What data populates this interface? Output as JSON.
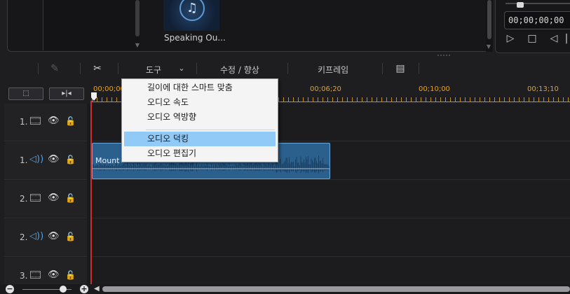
{
  "library": {
    "media_item_label": "Speaking Ou...",
    "media_icon": "music-note-icon"
  },
  "preview": {
    "timecode": "00;00;00;00"
  },
  "toolbar": {
    "tools_label": "도구",
    "fix_enhance_label": "수정 / 향상",
    "keyframe_label": "키프레임"
  },
  "ruler": {
    "labels": [
      "00;00;00",
      "00;06;20",
      "00;10;00",
      "00;13;10"
    ]
  },
  "tracks": [
    {
      "number": "1.",
      "kind": "video"
    },
    {
      "number": "1.",
      "kind": "audio"
    },
    {
      "number": "2.",
      "kind": "video"
    },
    {
      "number": "2.",
      "kind": "audio"
    },
    {
      "number": "3.",
      "kind": "video"
    }
  ],
  "audio_clip": {
    "label": "Mount"
  },
  "tools_menu": {
    "items": [
      {
        "label": "길이에 대한 스마트 맞춤"
      },
      {
        "label": "오디오 속도"
      },
      {
        "label": "오디오 역방향"
      },
      {
        "label": "오디오 덕킹"
      },
      {
        "label": "오디오 편집기"
      }
    ],
    "highlighted_index": 3
  },
  "colors": {
    "accent_blue": "#4ea3e8",
    "ruler_orange": "#e8a020",
    "playhead_red": "#d12a2a",
    "clip_blue": "#2b5f8c",
    "menu_highlight": "#91c9f7"
  }
}
